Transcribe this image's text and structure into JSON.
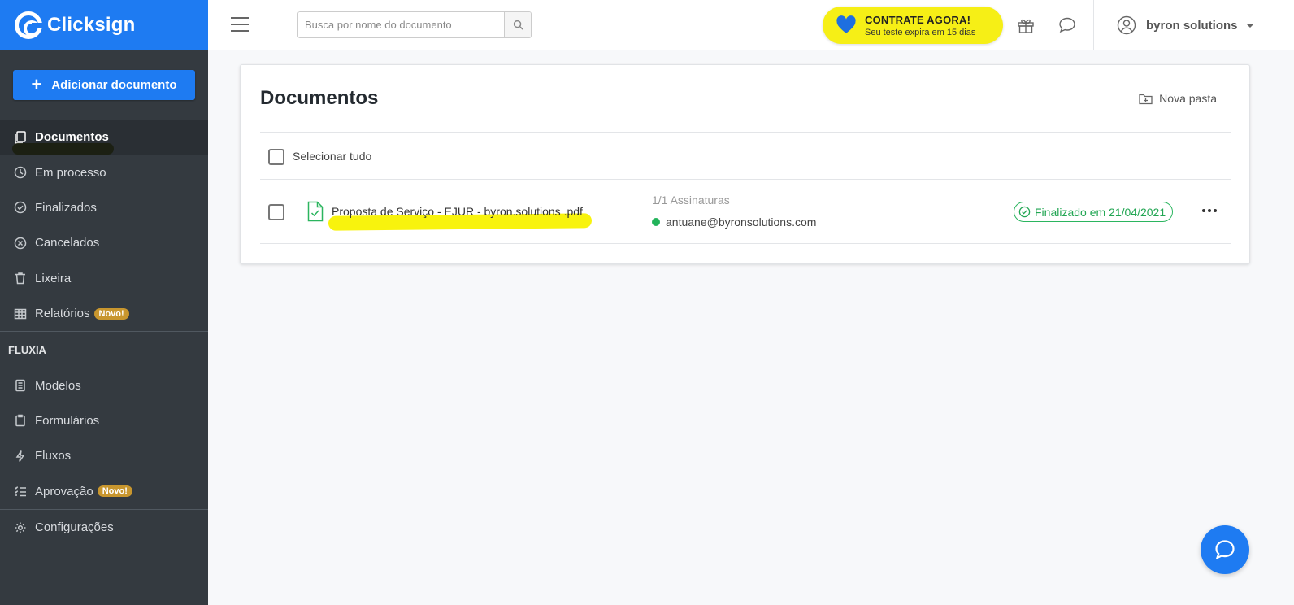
{
  "brand": {
    "name": "Clicksign",
    "color": "#1e7bf2"
  },
  "sidebar": {
    "add_button": "Adicionar documento",
    "items": [
      {
        "label": "Documentos",
        "icon": "documents-icon",
        "active": true
      },
      {
        "label": "Em processo",
        "icon": "clock-icon"
      },
      {
        "label": "Finalizados",
        "icon": "check-circle-icon"
      },
      {
        "label": "Cancelados",
        "icon": "x-circle-icon"
      },
      {
        "label": "Lixeira",
        "icon": "trash-icon"
      },
      {
        "label": "Relatórios",
        "icon": "table-icon",
        "badge": "Novo!"
      }
    ],
    "section_title": "FLUXIA",
    "fluxia_items": [
      {
        "label": "Modelos",
        "icon": "template-icon"
      },
      {
        "label": "Formulários",
        "icon": "clipboard-icon"
      },
      {
        "label": "Fluxos",
        "icon": "bolt-icon"
      },
      {
        "label": "Aprovação",
        "icon": "checklist-icon",
        "badge": "Novo!"
      }
    ],
    "settings": {
      "label": "Configurações",
      "icon": "gear-icon"
    }
  },
  "topbar": {
    "search_placeholder": "Busca por nome do documento",
    "promo": {
      "title": "CONTRATE AGORA!",
      "subtitle": "Seu teste expira em 15 dias",
      "color": "#f6ef16"
    },
    "user_name": "byron solutions"
  },
  "main": {
    "title": "Documentos",
    "new_folder": "Nova pasta",
    "select_all": "Selecionar tudo",
    "documents": [
      {
        "name": "Proposta de Serviço - EJUR - byron.solutions .pdf",
        "signatures": "1/1 Assinaturas",
        "signer": "antuane@byronsolutions.com",
        "status": "Finalizado em 21/04/2021",
        "status_color": "#22a653"
      }
    ]
  }
}
